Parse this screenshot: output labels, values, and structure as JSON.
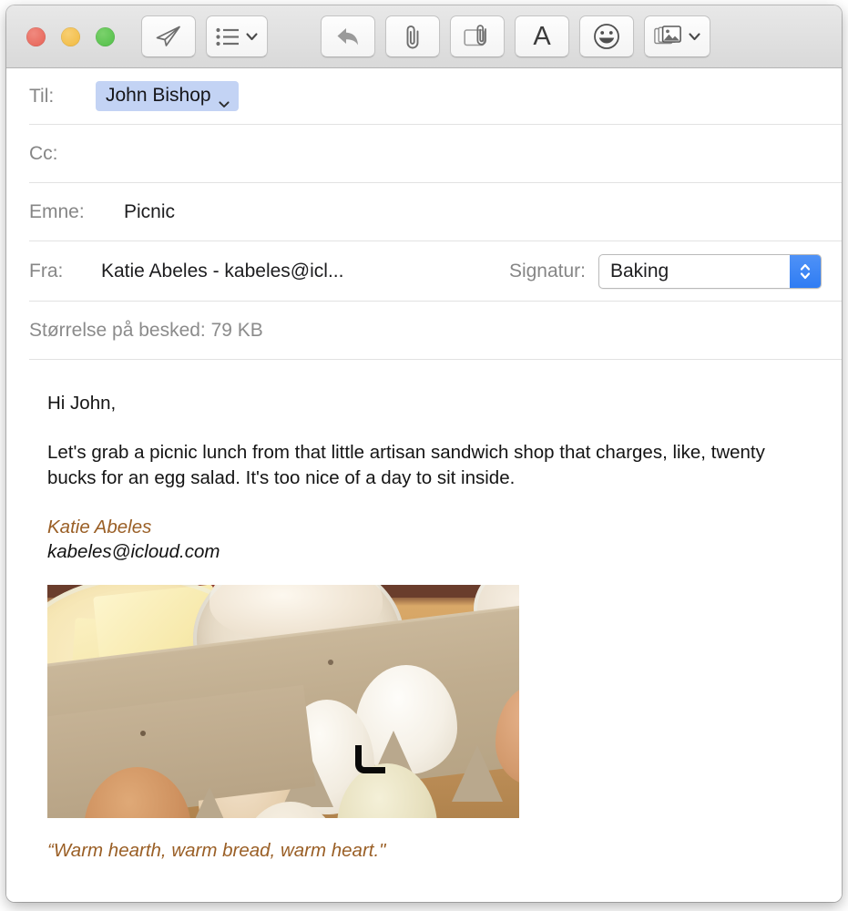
{
  "window": {
    "traffic_lights": [
      {
        "name": "close",
        "color": "#e66054"
      },
      {
        "name": "minimize",
        "color": "#f0b93f"
      },
      {
        "name": "zoom",
        "color": "#4fbe46"
      }
    ]
  },
  "toolbar": {
    "buttons": [
      {
        "name": "send-button",
        "icon": "paper-plane-icon",
        "label": ""
      },
      {
        "name": "header-fields-button",
        "icon": "list-bullets-icon",
        "label": "",
        "has_chevron": true
      },
      {
        "name": "reply-button",
        "icon": "reply-arrow-icon",
        "label": ""
      },
      {
        "name": "attach-button",
        "icon": "paperclip-icon",
        "label": ""
      },
      {
        "name": "markup-attachment-button",
        "icon": "card-paperclip-icon",
        "label": ""
      },
      {
        "name": "format-font-button",
        "icon": "letter-a-icon",
        "label": "A"
      },
      {
        "name": "emoji-button",
        "icon": "smiley-face-icon",
        "label": ""
      },
      {
        "name": "photo-browser-button",
        "icon": "photos-stack-icon",
        "label": "",
        "has_chevron": true
      }
    ]
  },
  "headers": {
    "to": {
      "label": "Til:",
      "recipient_token": "John Bishop",
      "placeholder": ""
    },
    "cc": {
      "label": "Cc:",
      "value": "",
      "placeholder": ""
    },
    "subject": {
      "label": "Emne:",
      "value": "Picnic",
      "placeholder": ""
    },
    "from": {
      "label": "Fra:",
      "value": "Katie Abeles - kabeles@icl..."
    },
    "signature": {
      "label": "Signatur:",
      "selected": "Baking"
    },
    "size": {
      "text": "Størrelse på besked: 79 KB"
    }
  },
  "message": {
    "greeting": "Hi John,",
    "paragraph": "Let's grab a picnic lunch from that little artisan sandwich shop that charges, like, twenty bucks for an egg salad. It's too nice of a day to sit inside.",
    "signature_name": "Katie Abeles",
    "signature_email": "kabeles@icloud.com",
    "photo_alt": "Baking ingredients: eggs in a carton, butter and flour in glass bowls on a wooden table",
    "quote": "“Warm hearth, warm bread, warm heart.\""
  },
  "colors": {
    "recipient_token_bg": "#c3d3f4",
    "signature_stepper_blue": "#2f7cf3",
    "signature_text_brown": "#9a5f26",
    "label_gray": "#868686"
  }
}
